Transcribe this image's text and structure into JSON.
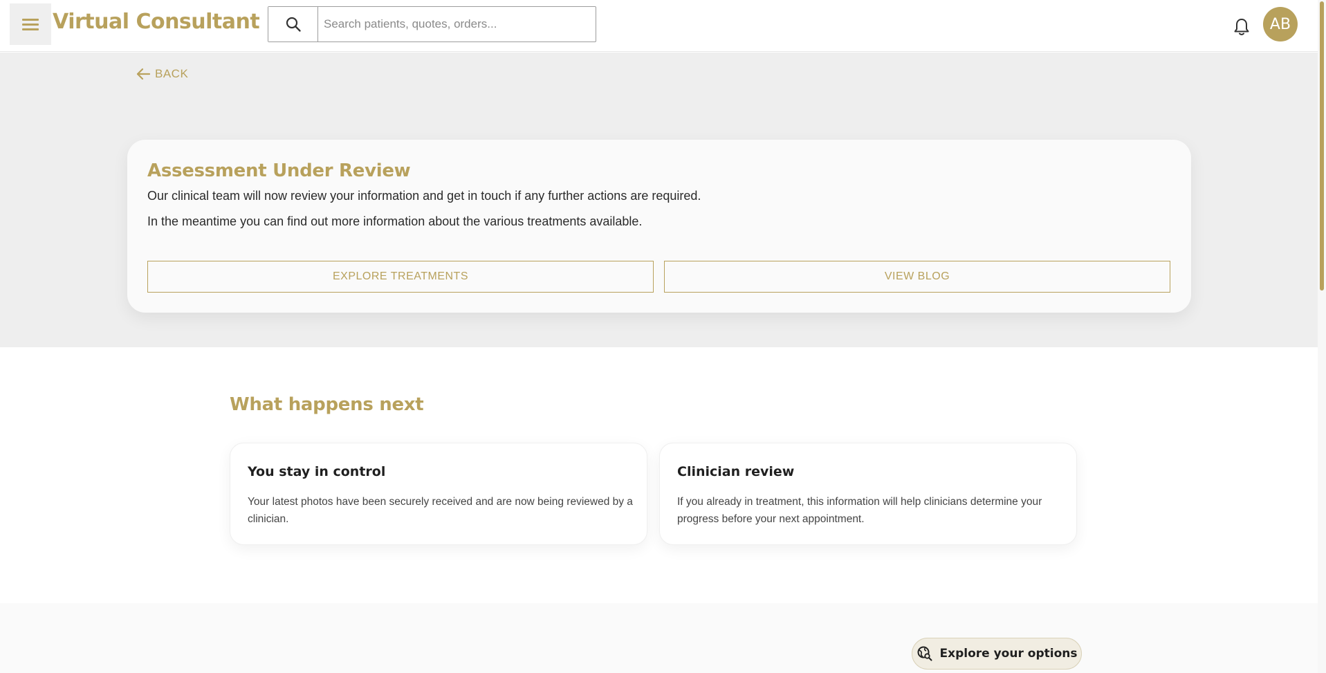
{
  "header": {
    "brand": "Virtual Consultant",
    "search_placeholder": "Search patients, quotes, orders...",
    "avatar_initials": "AB"
  },
  "nav": {
    "back_label": "BACK"
  },
  "review_card": {
    "title": "Assessment Under Review",
    "line1": "Our clinical team will now review your information and get in touch if any further actions are required.",
    "line2": "In the meantime you can find out more information about the various treatments available.",
    "explore_button": "EXPLORE TREATMENTS",
    "blog_button": "VIEW BLOG"
  },
  "next": {
    "heading": "What happens next",
    "cards": [
      {
        "title": "You stay in control",
        "body": "Your latest photos have been securely received and are now being reviewed by a clinician."
      },
      {
        "title": "Clinician review",
        "body": "If you already in treatment, this information will help clinicians determine your progress before your next appointment."
      }
    ]
  },
  "bottom": {
    "explore_options": "Explore your options"
  },
  "colors": {
    "accent": "#b8a15c",
    "hero_bg": "#eeeeee",
    "card_bg": "#fafafa"
  }
}
